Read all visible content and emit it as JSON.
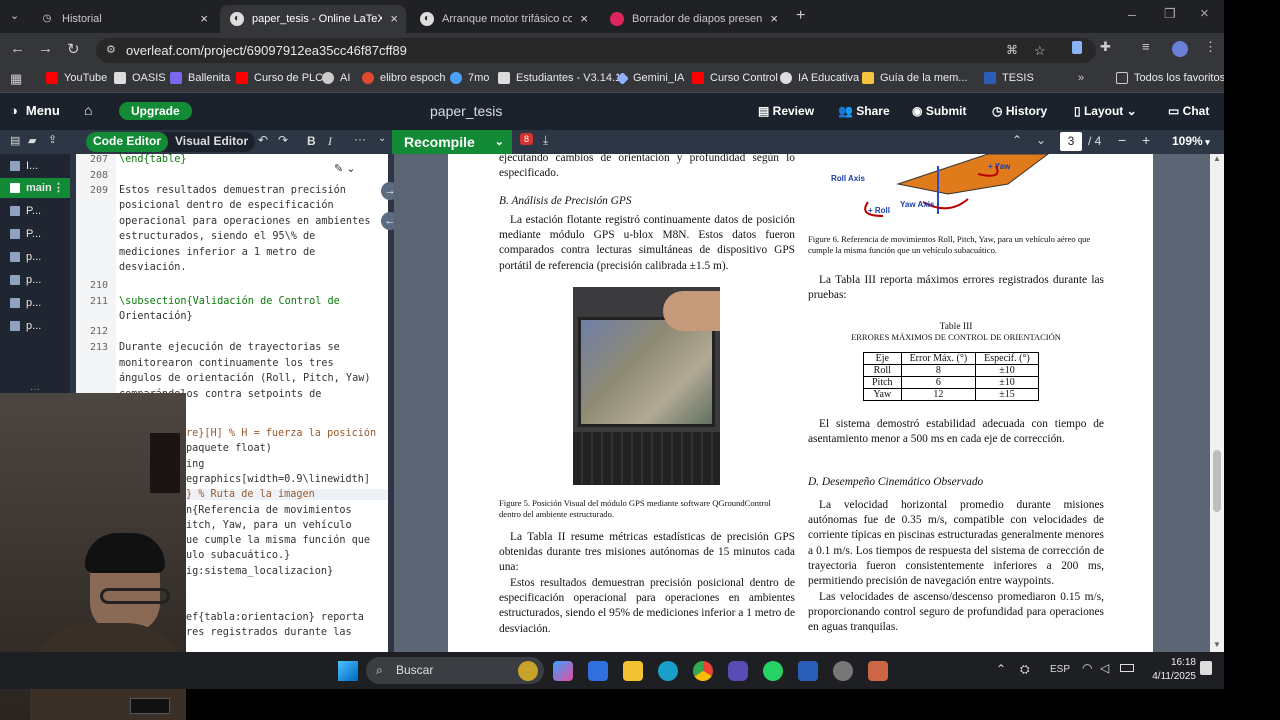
{
  "tabs": [
    {
      "label": "Historial",
      "active": false
    },
    {
      "label": "paper_tesis - Online LaTeX Editor",
      "active": true
    },
    {
      "label": "Arranque motor trifásico con PLC",
      "active": false
    },
    {
      "label": "Borrador de diapos presentación",
      "active": false
    }
  ],
  "address": {
    "url": "overleaf.com/project/69097912ea35cc46f87cff89"
  },
  "bookmarks": [
    "YouTube",
    "OASIS",
    "Ballenita",
    "Curso de PLC",
    "AI",
    "elibro espoch",
    "7mo",
    "Estudiantes - V3.14.1",
    "Gemini_IA",
    "Curso Control",
    "IA Educativa",
    "Guía de la mem...",
    "TESIS",
    "Todos los favoritos"
  ],
  "overleaf": {
    "menu": "Menu",
    "upgrade": "Upgrade",
    "project_title": "paper_tesis",
    "review": "Review",
    "share": "Share",
    "submit": "Submit",
    "history": "History",
    "layout": "Layout",
    "chat": "Chat",
    "code_editor": "Code Editor",
    "visual_editor": "Visual Editor",
    "recompile": "Recompile",
    "errors": "8",
    "page_current": "3",
    "page_total": "/ 4",
    "zoom": "109%"
  },
  "files": [
    "I...",
    "main",
    "P...",
    "P...",
    "p...",
    "p...",
    "p...",
    "p..."
  ],
  "editor_lines": [
    {
      "n": "207",
      "text": "\\end{table}"
    },
    {
      "n": "208",
      "text": ""
    },
    {
      "n": "209",
      "text": "Estos resultados demuestran precisión"
    },
    {
      "n": "",
      "text": "posicional dentro de especificación"
    },
    {
      "n": "",
      "text": "operacional para operaciones en ambientes"
    },
    {
      "n": "",
      "text": "estructurados, siendo el 95\\% de"
    },
    {
      "n": "",
      "text": "mediciones inferior a 1 metro de"
    },
    {
      "n": "",
      "text": "desviación."
    },
    {
      "n": "210",
      "text": ""
    },
    {
      "n": "211",
      "text": "\\subsection{Validación de Control de"
    },
    {
      "n": "",
      "text": "Orientación}"
    },
    {
      "n": "212",
      "text": ""
    },
    {
      "n": "213",
      "text": "Durante ejecución de trayectorias se"
    },
    {
      "n": "",
      "text": "monitorearon continuamente los tres"
    },
    {
      "n": "",
      "text": "ángulos de orientación (Roll, Pitch, Yaw)"
    },
    {
      "n": "",
      "text": "comparándolos contra setpoints de"
    }
  ],
  "editor_lines_lower": [
    "re}[H] % H = fuerza la posición",
    "paquete float)",
    "ing",
    "egraphics[width=0.9\\linewidth]",
    "} % Ruta de la imagen",
    "n{Referencia de movimientos",
    "itch, Yaw, para un vehículo",
    "ue cumple la misma función que",
    "ulo subacuático.}",
    "ig:sistema_localizacion}",
    "",
    "",
    "ef{tabla:orientacion} reporta",
    "res registrados durante las"
  ],
  "pdf": {
    "left_top": "ejecutando cambios de orientación y profundidad según lo especificado.",
    "sec_b": "B. Análisis de Precisión GPS",
    "para_b": "La estación flotante registró continuamente datos de posición mediante módulo GPS u-blox M8N. Estos datos fueron comparados contra lecturas simultáneas de dispositivo GPS portátil de referencia (precisión calibrada ±1.5 m).",
    "fig5_caption": "Figure 5. Posición Visual del módulo GPS mediante software QGroundControl dentro del ambiente estructurado.",
    "para_table2": "La Tabla II resume métricas estadísticas de precisión GPS obtenidas durante tres misiones autónomas de 15 minutos cada una:",
    "para_results": "Estos resultados demuestran precisión posicional dentro de especificación operacional para operaciones en ambientes estructurados, siendo el 95% de mediciones inferior a 1 metro de desviación.",
    "fig6_caption": "Figure 6. Referencia de movimientos Roll, Pitch, Yaw, para un vehículo aéreo que cumple la misma función que un vehículo subacuático.",
    "fig6_labels": [
      "Roll Axis",
      "+ Roll",
      "Yaw Axis",
      "+ Yaw"
    ],
    "para_table3": "La Tabla III reporta máximos errores registrados durante las pruebas:",
    "table3_title": "Table III",
    "table3_subtitle": "Errores Máximos de Control de Orientación",
    "table3_headers": [
      "Eje",
      "Error Máx. (°)",
      "Especif. (°)"
    ],
    "table3_rows": [
      [
        "Roll",
        "8",
        "±10"
      ],
      [
        "Pitch",
        "6",
        "±10"
      ],
      [
        "Yaw",
        "12",
        "±15"
      ]
    ],
    "para_stability": "El sistema demostró estabilidad adecuada con tiempo de asentamiento menor a 500 ms en cada eje de corrección.",
    "sec_d": "D. Desempeño Cinemático Observado",
    "para_d1": "La velocidad horizontal promedio durante misiones autónomas fue de 0.35 m/s, compatible con velocidades de corriente típicas en piscinas estructuradas generalmente menores a 0.1 m/s. Los tiempos de respuesta del sistema de corrección de trayectoria fueron consistentemente inferiores a 200 ms, permitiendo precisión de navegación entre waypoints.",
    "para_d2": "Las velocidades de ascenso/descenso promediaron 0.15 m/s, proporcionando control seguro de profundidad para operaciones en aguas tranquilas."
  },
  "taskbar": {
    "search": "Buscar",
    "lang": "ESP",
    "time": "16:18",
    "date": "4/11/2025"
  }
}
